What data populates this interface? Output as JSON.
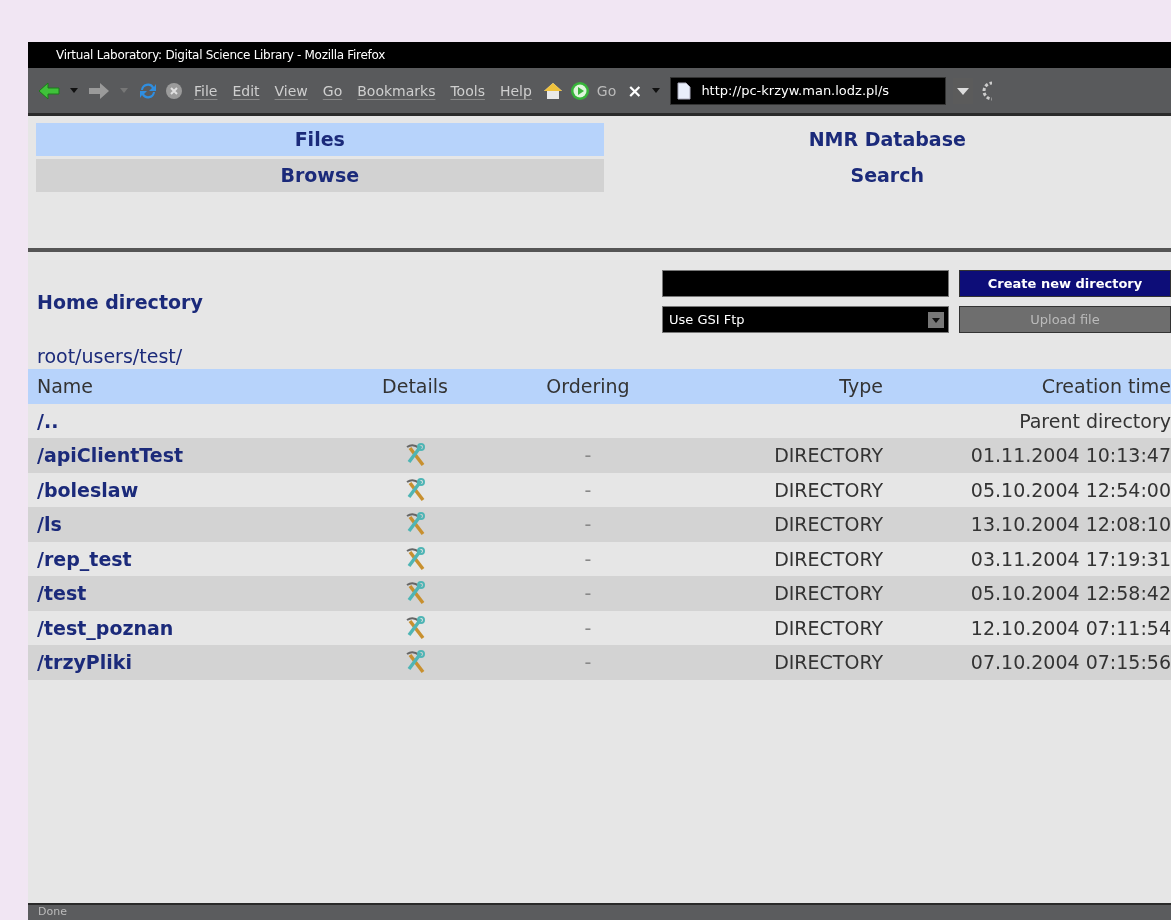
{
  "window": {
    "title": "Virtual Laboratory: Digital Science Library - Mozilla Firefox"
  },
  "menu": [
    "File",
    "Edit",
    "View",
    "Go",
    "Bookmarks",
    "Tools",
    "Help"
  ],
  "go_label": "Go",
  "stop_label": "×",
  "url": "http://pc-krzyw.man.lodz.pl/s",
  "nav_groups": [
    {
      "selected": true,
      "items": [
        "Files",
        "Browse"
      ]
    },
    {
      "selected": false,
      "items": [
        "NMR Database",
        "Search"
      ]
    }
  ],
  "home_title": "Home directory",
  "new_directory": {
    "button": "Create new directory",
    "disabled": false
  },
  "upload": {
    "method": "Use GSI Ftp",
    "button": "Upload file",
    "disabled": true
  },
  "path": "root/users/test/",
  "table": {
    "columns": [
      "Name",
      "Details",
      "Ordering",
      "Type",
      "Creation time"
    ],
    "rows": [
      {
        "kind": "parent",
        "name": "/..",
        "created": "Parent directory"
      },
      {
        "kind": "dir",
        "name": "/apiClientTest",
        "ordering": "-",
        "type": "DIRECTORY",
        "created": "01.11.2004 10:13:47"
      },
      {
        "kind": "dir",
        "name": "/boleslaw",
        "ordering": "-",
        "type": "DIRECTORY",
        "created": "05.10.2004 12:54:00"
      },
      {
        "kind": "dir",
        "name": "/ls",
        "ordering": "-",
        "type": "DIRECTORY",
        "created": "13.10.2004 12:08:10"
      },
      {
        "kind": "dir",
        "name": "/rep_test",
        "ordering": "-",
        "type": "DIRECTORY",
        "created": "03.11.2004 17:19:31"
      },
      {
        "kind": "dir",
        "name": "/test",
        "ordering": "-",
        "type": "DIRECTORY",
        "created": "05.10.2004 12:58:42"
      },
      {
        "kind": "dir",
        "name": "/test_poznan",
        "ordering": "-",
        "type": "DIRECTORY",
        "created": "12.10.2004 07:11:54"
      },
      {
        "kind": "dir",
        "name": "/trzyPliki",
        "ordering": "-",
        "type": "DIRECTORY",
        "created": "07.10.2004 07:15:56"
      }
    ]
  },
  "status_bar": "Done"
}
